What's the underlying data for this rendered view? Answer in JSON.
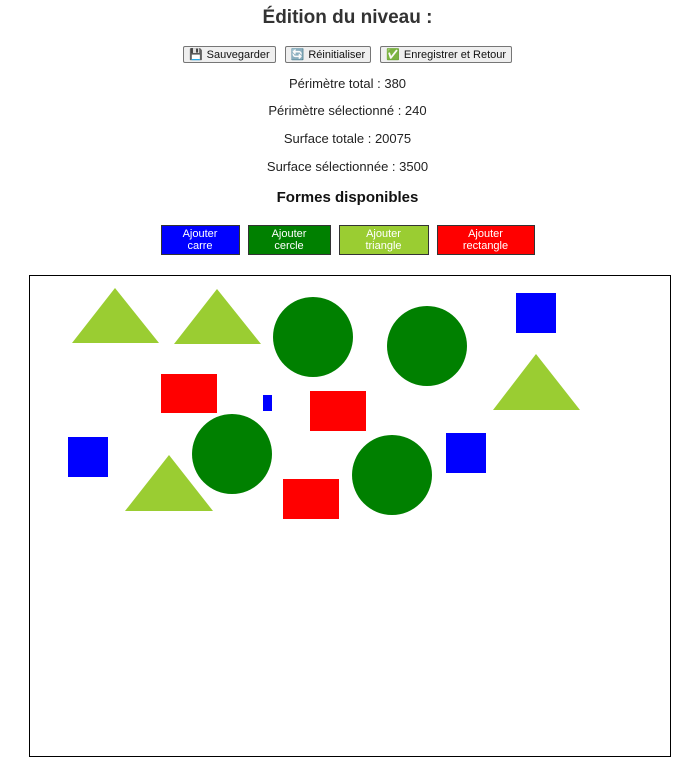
{
  "page": {
    "title": "Édition du niveau :"
  },
  "toolbar": {
    "save": {
      "icon": "floppy-disk-icon",
      "glyph": "💾",
      "label": "Sauvegarder"
    },
    "reset": {
      "icon": "refresh-icon",
      "glyph": "🔄",
      "label": "Réinitialiser"
    },
    "save_return": {
      "icon": "check-icon",
      "glyph": "✅",
      "label": "Enregistrer et Retour"
    }
  },
  "stats": {
    "perimeter_total": "Périmètre total : 380",
    "perimeter_selected": "Périmètre sélectionné : 240",
    "area_total": "Surface totale : 20075",
    "area_selected": "Surface sélectionnée : 3500"
  },
  "shapes_section": {
    "title": "Formes disponibles",
    "buttons": [
      {
        "label": "Ajouter carre",
        "color": "#0000ff"
      },
      {
        "label": "Ajouter cercle",
        "color": "#008000"
      },
      {
        "label": "Ajouter triangle",
        "color": "#9acd32"
      },
      {
        "label": "Ajouter rectangle",
        "color": "#ff0000"
      }
    ]
  },
  "colors": {
    "square": "#0000ff",
    "circle": "#008000",
    "triangle": "#9acd32",
    "rectangle": "#ff0000"
  }
}
